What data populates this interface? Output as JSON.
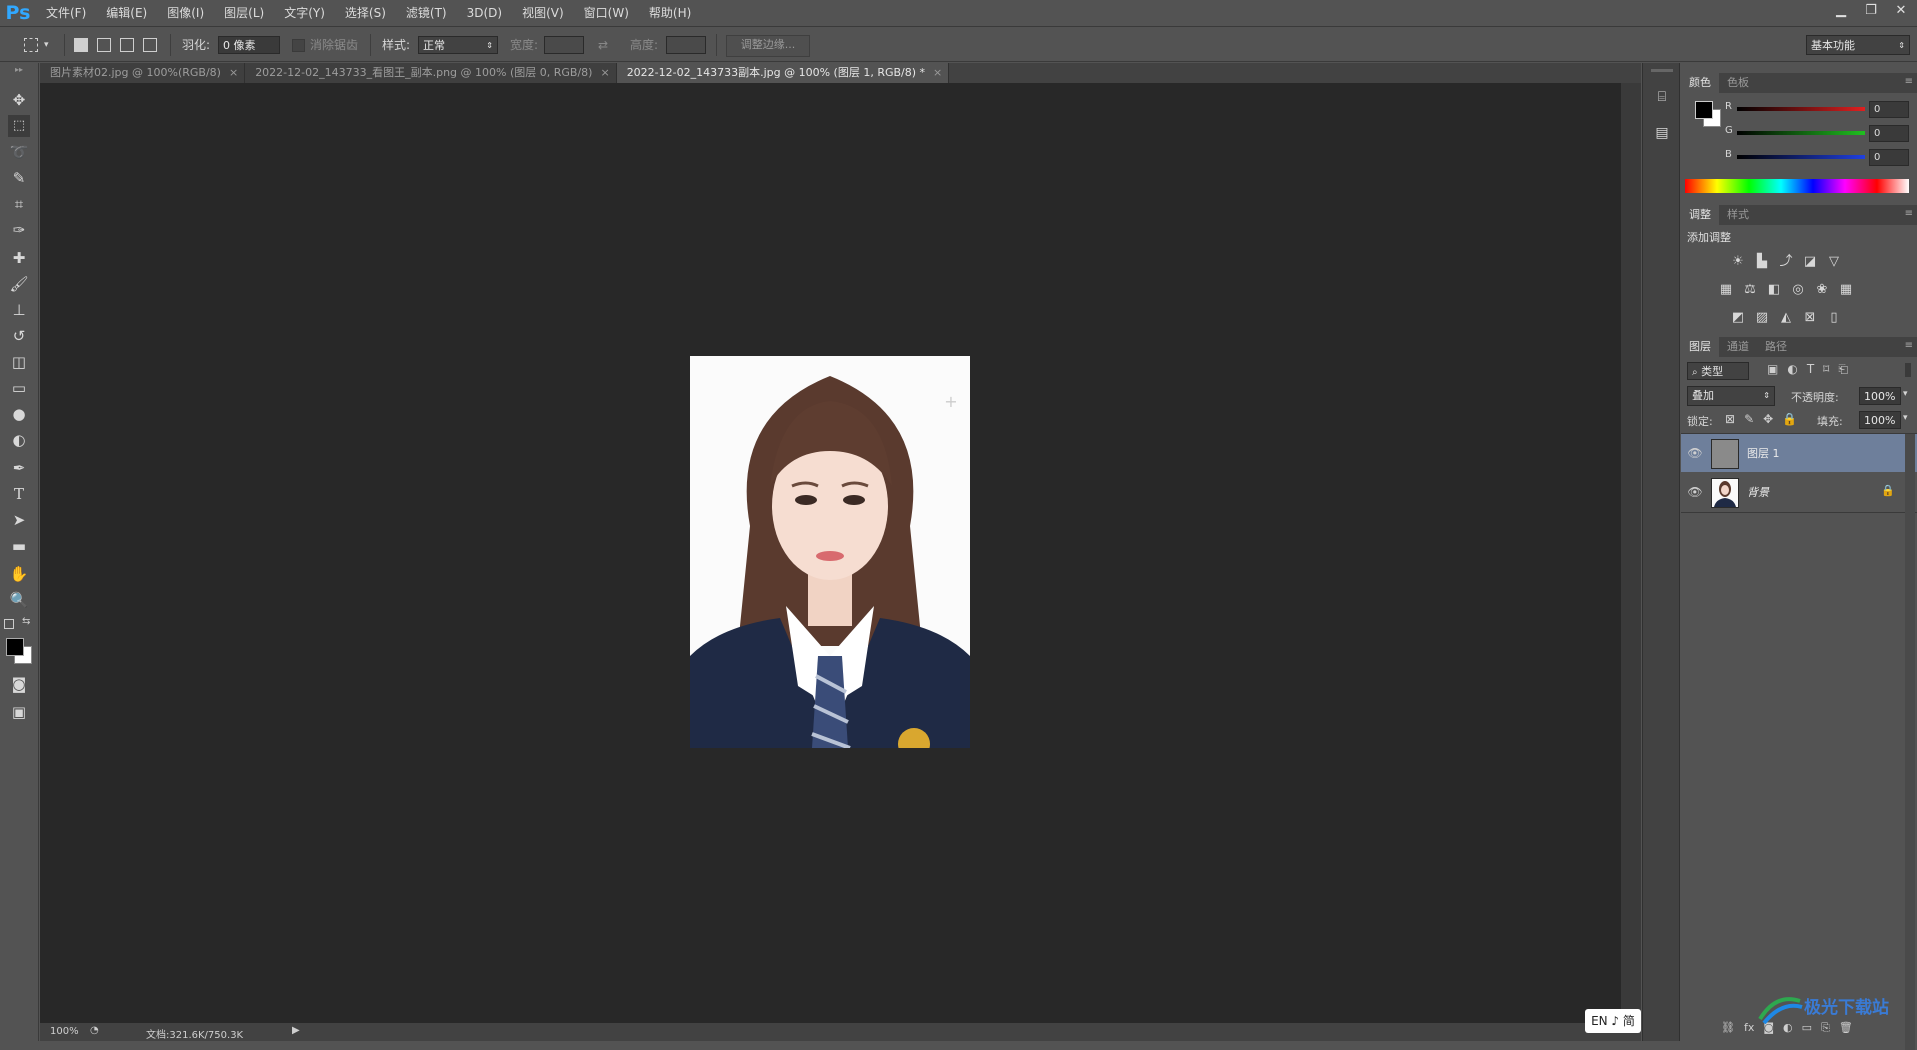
{
  "app": {
    "logo": "Ps"
  },
  "menu": [
    "文件(F)",
    "编辑(E)",
    "图像(I)",
    "图层(L)",
    "文字(Y)",
    "选择(S)",
    "滤镜(T)",
    "3D(D)",
    "视图(V)",
    "窗口(W)",
    "帮助(H)"
  ],
  "options": {
    "feather_label": "羽化:",
    "feather_value": "0 像素",
    "antialias_label": "消除锯齿",
    "style_label": "样式:",
    "style_value": "正常",
    "width_label": "宽度:",
    "height_label": "高度:",
    "refine_edge": "调整边缘...",
    "workspace": "基本功能"
  },
  "tabs": [
    {
      "label": "图片素材02.jpg @ 100%(RGB/8)",
      "active": false
    },
    {
      "label": "2022-12-02_143733_看图王_副本.png @ 100% (图层 0, RGB/8)",
      "active": false
    },
    {
      "label": "2022-12-02_143733副本.jpg @ 100% (图层 1, RGB/8) *",
      "active": true
    }
  ],
  "status": {
    "zoom": "100%",
    "doc": "文档:321.6K/750.3K"
  },
  "color_panel": {
    "tabs": [
      "颜色",
      "色板"
    ],
    "channels": [
      {
        "label": "R",
        "value": "0",
        "color": "#e02020"
      },
      {
        "label": "G",
        "value": "0",
        "color": "#20c020"
      },
      {
        "label": "B",
        "value": "0",
        "color": "#2040e0"
      }
    ]
  },
  "adjust_panel": {
    "tabs": [
      "调整",
      "样式"
    ],
    "title": "添加调整"
  },
  "layers_panel": {
    "tabs": [
      "图层",
      "通道",
      "路径"
    ],
    "filter": "类型",
    "blend_mode": "叠加",
    "opacity_label": "不透明度:",
    "opacity_value": "100%",
    "lock_label": "锁定:",
    "fill_label": "填充:",
    "fill_value": "100%",
    "layers": [
      {
        "name": "图层 1",
        "selected": true
      },
      {
        "name": "背景",
        "selected": false,
        "locked": true
      }
    ]
  },
  "ime": {
    "label": "EN ♪ 简"
  },
  "watermark": {
    "text": "极光下载站"
  }
}
